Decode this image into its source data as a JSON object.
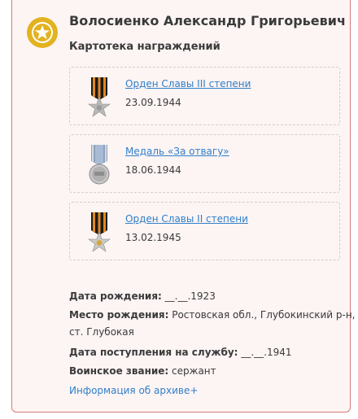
{
  "person": {
    "name": "Волосиенко Александр Григорьевич",
    "section_title": "Картотека награждений"
  },
  "awards": [
    {
      "title": "Орден Славы III степени",
      "date": "23.09.1944",
      "icon": "order-of-glory-icon"
    },
    {
      "title": "Медаль «За отвагу»",
      "date": "18.06.1944",
      "icon": "medal-for-courage-icon"
    },
    {
      "title": "Орден Славы II степени",
      "date": "13.02.1945",
      "icon": "order-of-glory-icon"
    }
  ],
  "details": {
    "birth_date_label": "Дата рождения:",
    "birth_date_value": "__.__.1923",
    "birth_place_label": "Место рождения:",
    "birth_place_value_line1": "Ростовская обл., Глубокинский р-н,",
    "birth_place_value_line2": "ст. Глубокая",
    "service_date_label": "Дата поступления на службу:",
    "service_date_value": "__.__.1941",
    "rank_label": "Воинское звание:",
    "rank_value": "сержант",
    "archive_link": "Информация об архиве+"
  },
  "colors": {
    "accent": "#e3b21f",
    "link": "#2f7fc8",
    "card_border": "#d87a7a",
    "card_background": "#fdf4f4"
  }
}
